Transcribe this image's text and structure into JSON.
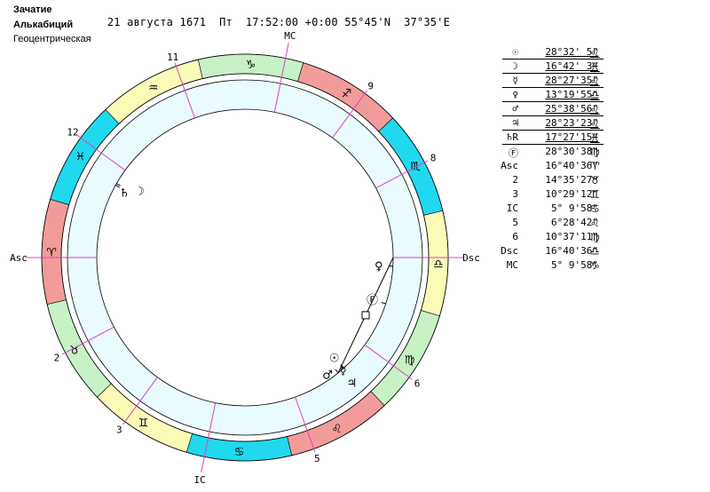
{
  "header": {
    "title": "Зачатие",
    "date": "21 августа 1671",
    "weekday": "Пт",
    "time": "17:52:00",
    "zone": "+0:00",
    "lat": "55°45'N",
    "lon": "37°35'E",
    "house_system": "Алькабиций",
    "mode": "Геоцентрическая"
  },
  "colors": {
    "fire": "#f29b9b",
    "earth": "#c6f2c6",
    "air": "#fbfbb8",
    "water": "#21d9ef",
    "inner_band": "#e9fbfd",
    "cusp_line": "#e040c0"
  },
  "wheel": {
    "asc_longitude": 16.68,
    "signs": [
      {
        "glyph": "♈",
        "name": "aries-icon",
        "element": "fire"
      },
      {
        "glyph": "♉",
        "name": "taurus-icon",
        "element": "earth"
      },
      {
        "glyph": "♊",
        "name": "gemini-icon",
        "element": "air"
      },
      {
        "glyph": "♋",
        "name": "cancer-icon",
        "element": "water"
      },
      {
        "glyph": "♌",
        "name": "leo-icon",
        "element": "fire"
      },
      {
        "glyph": "♍",
        "name": "virgo-icon",
        "element": "earth"
      },
      {
        "glyph": "♎",
        "name": "libra-icon",
        "element": "air"
      },
      {
        "glyph": "♏",
        "name": "scorpio-icon",
        "element": "water"
      },
      {
        "glyph": "♐",
        "name": "sagittarius-icon",
        "element": "fire"
      },
      {
        "glyph": "♑",
        "name": "capricorn-icon",
        "element": "earth"
      },
      {
        "glyph": "♒",
        "name": "aquarius-icon",
        "element": "air"
      },
      {
        "glyph": "♓",
        "name": "pisces-icon",
        "element": "water"
      }
    ],
    "cusps": [
      {
        "label": "Asc",
        "longitude": 16.68
      },
      {
        "label": "2",
        "longitude": 44.59
      },
      {
        "label": "3",
        "longitude": 70.49
      },
      {
        "label": "IC",
        "longitude": 95.17
      },
      {
        "label": "5",
        "longitude": 126.48
      },
      {
        "label": "6",
        "longitude": 160.62
      },
      {
        "label": "Dsc",
        "longitude": 196.68
      },
      {
        "label": "8",
        "longitude": 224.59
      },
      {
        "label": "9",
        "longitude": 250.49
      },
      {
        "label": "MC",
        "longitude": 275.17
      },
      {
        "label": "11",
        "longitude": 306.48
      },
      {
        "label": "12",
        "longitude": 340.62
      }
    ],
    "planets_on_wheel": [
      {
        "glyph": "☉",
        "name": "sun-icon",
        "longitude": 148.54
      },
      {
        "glyph": "☽",
        "name": "moon-icon",
        "longitude": 346.71
      },
      {
        "glyph": "☿",
        "name": "mercury-icon",
        "longitude": 148.46
      },
      {
        "glyph": "♀",
        "name": "venus-icon",
        "longitude": 193.33
      },
      {
        "glyph": "♂",
        "name": "mars-icon",
        "longitude": 145.65
      },
      {
        "glyph": "♃",
        "name": "jupiter-icon",
        "longitude": 148.39
      },
      {
        "glyph": "♄",
        "name": "saturn-icon",
        "longitude": 347.45
      },
      {
        "glyph": "Ⓕ",
        "name": "fortune-icon",
        "longitude": 178.51
      }
    ],
    "aspect_line": {
      "from": 145.65,
      "to": 196.68
    }
  },
  "positions": [
    {
      "glyph": "☉",
      "name": "sun",
      "value": "28°32' 5\"",
      "sign": "♌",
      "underline": true
    },
    {
      "glyph": "☽",
      "name": "moon",
      "value": "16°42' 3\"",
      "sign": "♓",
      "underline": true
    },
    {
      "glyph": "☿",
      "name": "mercury",
      "value": "28°27'35\"",
      "sign": "♌",
      "underline": true
    },
    {
      "glyph": "♀",
      "name": "venus",
      "value": "13°19'55\"",
      "sign": "♎",
      "underline": true
    },
    {
      "glyph": "♂",
      "name": "mars",
      "value": "25°38'56\"",
      "sign": "♌",
      "underline": true
    },
    {
      "glyph": "♃",
      "name": "jupiter",
      "value": "28°23'23\"",
      "sign": "♌",
      "underline": true
    },
    {
      "glyph": "♄R",
      "name": "saturn",
      "value": "17°27'15\"",
      "sign": "♓",
      "underline": true
    },
    {
      "glyph": "Ⓕ",
      "name": "fortune",
      "value": "28°30'38\"",
      "sign": "♍",
      "underline": false
    },
    {
      "glyph": "Asc",
      "name": "asc",
      "value": "16°40'36\"",
      "sign": "♈",
      "underline": false
    },
    {
      "glyph": "2",
      "name": "house-2",
      "value": "14°35'27\"",
      "sign": "♉",
      "underline": false
    },
    {
      "glyph": "3",
      "name": "house-3",
      "value": "10°29'12\"",
      "sign": "♊",
      "underline": false
    },
    {
      "glyph": "IC",
      "name": "ic",
      "value": "5° 9'58\"",
      "sign": "♋",
      "underline": false
    },
    {
      "glyph": "5",
      "name": "house-5",
      "value": "6°28'42\"",
      "sign": "♌",
      "underline": false
    },
    {
      "glyph": "6",
      "name": "house-6",
      "value": "10°37'11\"",
      "sign": "♍",
      "underline": false
    },
    {
      "glyph": "Dsc",
      "name": "dsc",
      "value": "16°40'36\"",
      "sign": "♎",
      "underline": false
    },
    {
      "glyph": "MC",
      "name": "mc",
      "value": "5° 9'58\"",
      "sign": "♑",
      "underline": false
    }
  ]
}
